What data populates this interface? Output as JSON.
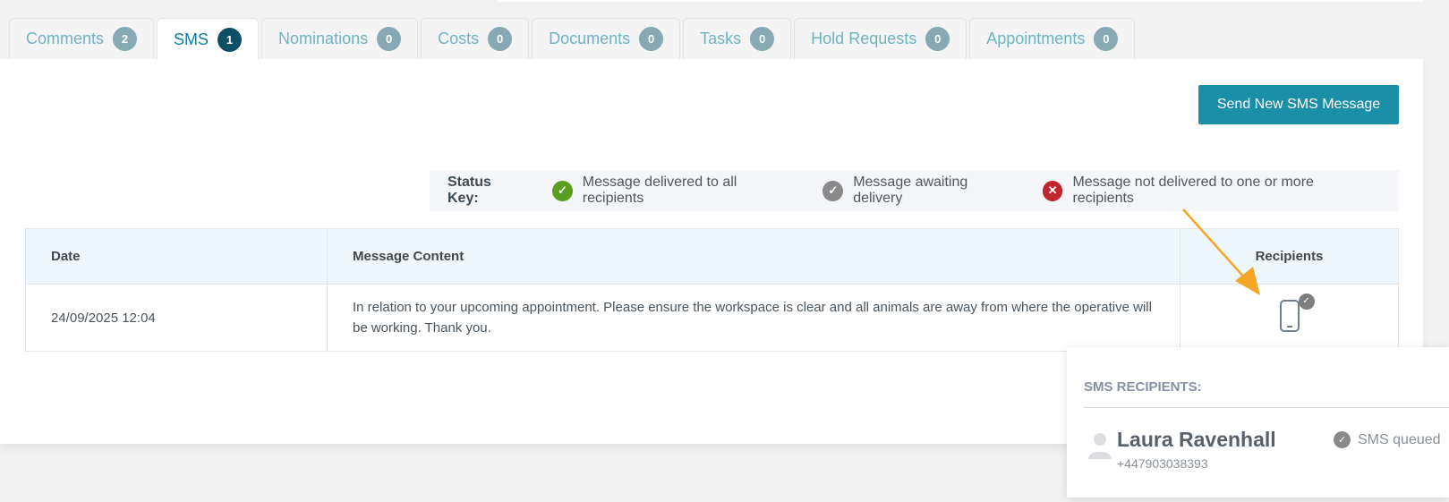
{
  "tabs": [
    {
      "label": "Comments",
      "count": "2"
    },
    {
      "label": "SMS",
      "count": "1"
    },
    {
      "label": "Nominations",
      "count": "0"
    },
    {
      "label": "Costs",
      "count": "0"
    },
    {
      "label": "Documents",
      "count": "0"
    },
    {
      "label": "Tasks",
      "count": "0"
    },
    {
      "label": "Hold Requests",
      "count": "0"
    },
    {
      "label": "Appointments",
      "count": "0"
    }
  ],
  "toolbar": {
    "send_label": "Send New SMS Message"
  },
  "status_key": {
    "title": "Status Key:",
    "delivered": "Message delivered to all recipients",
    "awaiting": "Message awaiting delivery",
    "failed": "Message not delivered to one or more recipients",
    "icons": {
      "delivered": "check-icon",
      "awaiting": "check-icon",
      "failed": "x-icon"
    },
    "colors": {
      "delivered": "#5a9e1f",
      "awaiting": "#8a8a8a",
      "failed": "#c1262c"
    }
  },
  "table": {
    "headers": {
      "date": "Date",
      "content": "Message Content",
      "recipients": "Recipients"
    },
    "rows": [
      {
        "date": "24/09/2025 12:04",
        "content": "In relation to your upcoming appointment. Please ensure the workspace is clear and all animals are away from where the operative will be working. Thank you."
      }
    ]
  },
  "popup": {
    "title": "SMS RECIPIENTS:",
    "recipient_name": "Laura Ravenhall",
    "recipient_phone": "+447903038393",
    "status": "SMS queued"
  },
  "colors": {
    "accent": "#1b8ea8",
    "tab_text": "#6fb4c3",
    "arrow": "#f5a623"
  }
}
